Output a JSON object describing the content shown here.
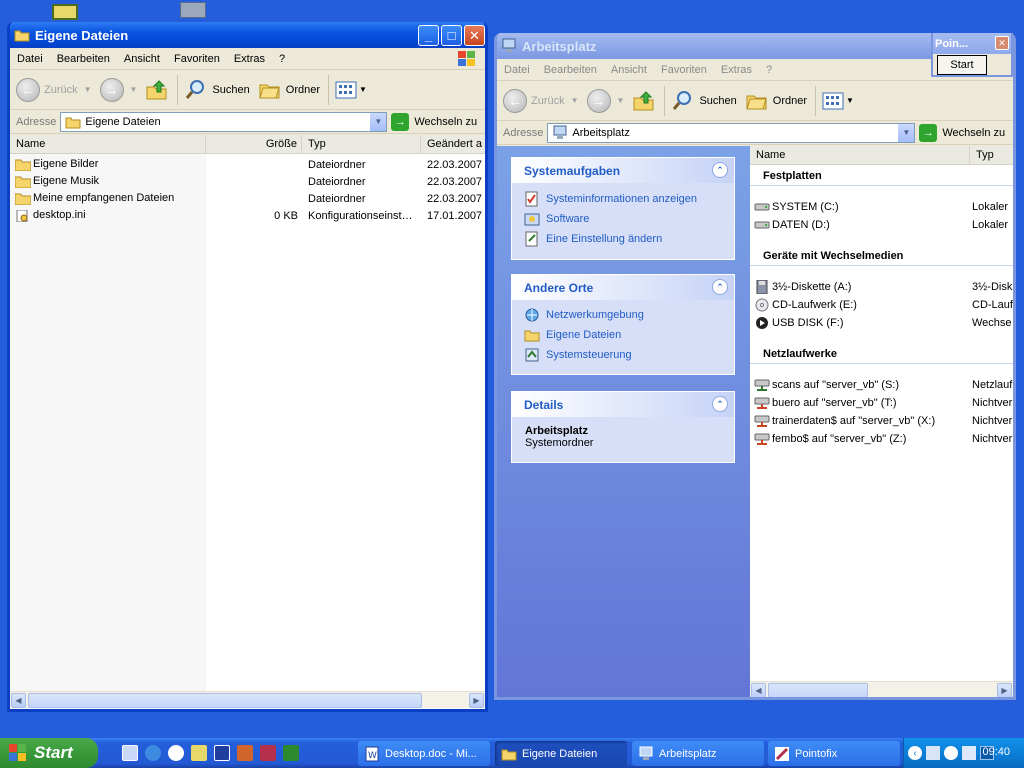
{
  "colors": {
    "desktop": "#245EDC",
    "title_active": "#0A54E0",
    "link": "#215DC6"
  },
  "window_left": {
    "title": "Eigene Dateien",
    "menu": [
      "Datei",
      "Bearbeiten",
      "Ansicht",
      "Favoriten",
      "Extras",
      "?"
    ],
    "toolbar": {
      "back": "Zurück",
      "search": "Suchen",
      "folders": "Ordner"
    },
    "address_label": "Adresse",
    "address_value": "Eigene Dateien",
    "go_label": "Wechseln zu",
    "columns": [
      "Name",
      "Größe",
      "Typ",
      "Geändert a"
    ],
    "files": [
      {
        "name": "Eigene Bilder",
        "size": "",
        "type": "Dateiordner",
        "date": "22.03.2007"
      },
      {
        "name": "Eigene Musik",
        "size": "",
        "type": "Dateiordner",
        "date": "22.03.2007"
      },
      {
        "name": "Meine empfangenen Dateien",
        "size": "",
        "type": "Dateiordner",
        "date": "22.03.2007"
      },
      {
        "name": "desktop.ini",
        "size": "0 KB",
        "type": "Konfigurationseinst…",
        "date": "17.01.2007"
      }
    ]
  },
  "window_right": {
    "title": "Arbeitsplatz",
    "menu": [
      "Datei",
      "Bearbeiten",
      "Ansicht",
      "Favoriten",
      "Extras",
      "?"
    ],
    "toolbar": {
      "back": "Zurück",
      "search": "Suchen",
      "folders": "Ordner"
    },
    "address_label": "Adresse",
    "address_value": "Arbeitsplatz",
    "go_label": "Wechseln zu",
    "tasks": {
      "system_title": "Systemaufgaben",
      "system_links": [
        "Systeminformationen anzeigen",
        "Software",
        "Eine Einstellung ändern"
      ],
      "other_title": "Andere Orte",
      "other_links": [
        "Netzwerkumgebung",
        "Eigene Dateien",
        "Systemsteuerung"
      ],
      "details_title": "Details",
      "details_name": "Arbeitsplatz",
      "details_type": "Systemordner"
    },
    "columns": [
      "Name",
      "Typ"
    ],
    "sections": {
      "hdd": "Festplatten",
      "removable": "Geräte mit Wechselmedien",
      "network": "Netzlaufwerke"
    },
    "hdd": [
      {
        "name": "SYSTEM (C:)",
        "type": "Lokaler"
      },
      {
        "name": "DATEN (D:)",
        "type": "Lokaler"
      }
    ],
    "removable": [
      {
        "name": "3½-Diskette (A:)",
        "type": "3½-Disk"
      },
      {
        "name": "CD-Laufwerk (E:)",
        "type": "CD-Lauf"
      },
      {
        "name": "USB DISK (F:)",
        "type": "Wechse"
      }
    ],
    "network": [
      {
        "name": "scans auf \"server_vb\" (S:)",
        "type": "Netzlauf"
      },
      {
        "name": "buero auf \"server_vb\" (T:)",
        "type": "Nichtver"
      },
      {
        "name": "trainerdaten$ auf \"server_vb\" (X:)",
        "type": "Nichtver"
      },
      {
        "name": "fembo$ auf \"server_vb\" (Z:)",
        "type": "Nichtver"
      }
    ]
  },
  "pointofix": {
    "title": "Poin...",
    "button": "Start"
  },
  "taskbar": {
    "start": "Start",
    "tasks": [
      "Desktop.doc - Mi...",
      "Eigene Dateien",
      "Arbeitsplatz",
      "Pointofix"
    ],
    "clock": "09:40"
  }
}
